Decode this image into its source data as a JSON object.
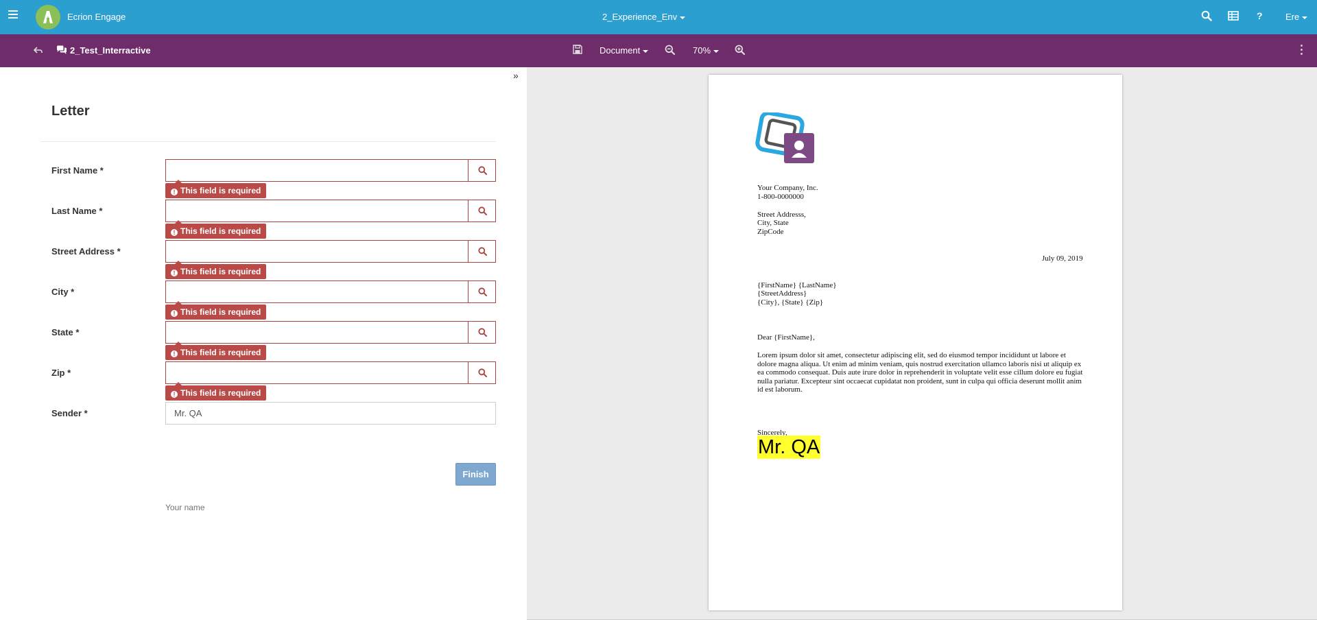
{
  "app": {
    "name": "Ecrion Engage",
    "environment": "2_Experience_Env",
    "user": "Ere",
    "help_label": "?"
  },
  "toolbar": {
    "document_title": "2_Test_Interractive",
    "document_menu_label": "Document",
    "zoom_level": "70%"
  },
  "form": {
    "title": "Letter",
    "error_message": "This field is required",
    "fields": [
      {
        "label": "First Name *",
        "value": "",
        "required_error": true
      },
      {
        "label": "Last Name *",
        "value": "",
        "required_error": true
      },
      {
        "label": "Street Address *",
        "value": "",
        "required_error": true
      },
      {
        "label": "City *",
        "value": "",
        "required_error": true
      },
      {
        "label": "State *",
        "value": "",
        "required_error": true
      },
      {
        "label": "Zip *",
        "value": "",
        "required_error": true
      }
    ],
    "sender": {
      "label": "Sender *",
      "value": "Mr. QA",
      "help_text": "Your name"
    },
    "finish_label": "Finish"
  },
  "preview": {
    "company_name": "Your Company, Inc.",
    "phone": "1-800-0000000",
    "street": "Street Addresss,",
    "city_state": "City, State",
    "zip": "ZipCode",
    "date": "July 09, 2019",
    "recipient_name": "{FirstName} {LastName}",
    "recipient_street": "{StreetAddress}",
    "recipient_city": "{City}, {State} {Zip}",
    "salutation": "Dear {FirstName},",
    "body": "Lorem ipsum dolor sit amet, consectetur adipiscing elit, sed do eiusmod tempor incididunt ut labore et dolore magna aliqua. Ut enim ad minim veniam, quis nostrud exercitation ullamco laboris nisi ut aliquip ex ea commodo consequat. Duis aute irure dolor in reprehenderit in voluptate velit esse cillum dolore eu fugiat nulla pariatur. Excepteur sint occaecat cupidatat non proident, sunt in culpa qui officia deserunt mollit anim id est laborum.",
    "closing": "Sincerely,",
    "signature": "Mr. QA"
  },
  "colors": {
    "topbar": "#2b9fcf",
    "toolbar": "#6e2c6b",
    "error": "#b94a48",
    "finish_button": "#7ea8cf",
    "signature_highlight": "#ffff2e"
  },
  "icons": [
    "hamburger-icon",
    "logo-icon",
    "search-icon",
    "grid-icon",
    "help-icon",
    "back-icon",
    "comments-icon",
    "save-icon",
    "zoom-out-icon",
    "zoom-in-icon",
    "kebab-icon",
    "collapse-icon"
  ]
}
